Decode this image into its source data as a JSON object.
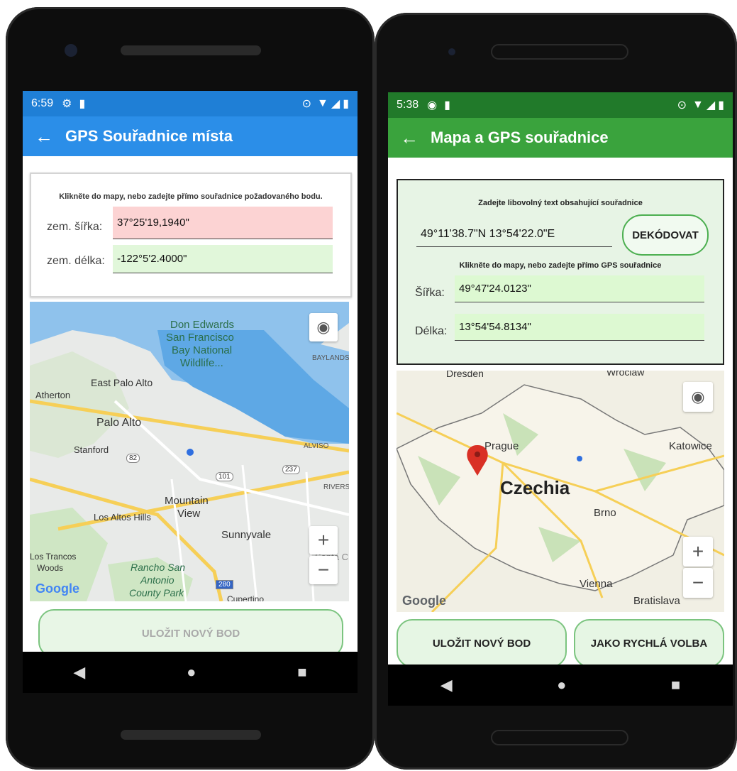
{
  "left": {
    "status": {
      "time": "6:59"
    },
    "appbar": {
      "title": "GPS Souřadnice místa",
      "back_icon": "arrow-left-icon"
    },
    "form": {
      "instruction": "Klikněte do mapy, nebo zadejte přímo souřadnice požadovaného bodu.",
      "lat_label": "zem. šířka:",
      "lat_value": "37°25'19,1940\"",
      "lon_label": "zem. délka:",
      "lon_value": "-122°5'2.4000\""
    },
    "map": {
      "labels": [
        "Don Edwards",
        "San Francisco",
        "Bay National",
        "Wildlife...",
        "BAYLANDS",
        "East Palo Alto",
        "Atherton",
        "Palo Alto",
        "Stanford",
        "ALVISO",
        "RIVERS",
        "Mountain",
        "View",
        "Los Altos Hills",
        "Sunnyvale",
        "Los Trancos",
        "Woods",
        "Rancho San",
        "Antonio",
        "County Park",
        "Santa C",
        "Cupertino"
      ],
      "road_shields": [
        "82",
        "101",
        "237",
        "280"
      ],
      "zoom_in": "+",
      "zoom_out": "−",
      "logo": "Google"
    },
    "save_button": "ULOŽIT NOVÝ BOD"
  },
  "right": {
    "status": {
      "time": "5:38"
    },
    "appbar": {
      "title": "Mapa a GPS souřadnice",
      "back_icon": "arrow-left-icon"
    },
    "form": {
      "text_instruction": "Zadejte libovolný text obsahující souřadnice",
      "text_value": "49°11'38.7\"N 13°54'22.0\"E",
      "decode_button": "DEKÓDOVAT",
      "instruction": "Klikněte do mapy, nebo zadejte přímo GPS souřadnice",
      "lat_label": "Šířka:",
      "lat_value": "49°47'24.0123\"",
      "lon_label": "Délka:",
      "lon_value": "13°54'54.8134\""
    },
    "map": {
      "labels": [
        "Dresden",
        "Wroclaw",
        "Prague",
        "Katowice",
        "Czechia",
        "Brno",
        "Vienna",
        "Bratislava"
      ],
      "zoom_in": "+",
      "zoom_out": "−",
      "logo": "Google"
    },
    "save_button": "ULOŽIT NOVÝ BOD",
    "quick_button": "JAKO RYCHLÁ VOLBA"
  }
}
